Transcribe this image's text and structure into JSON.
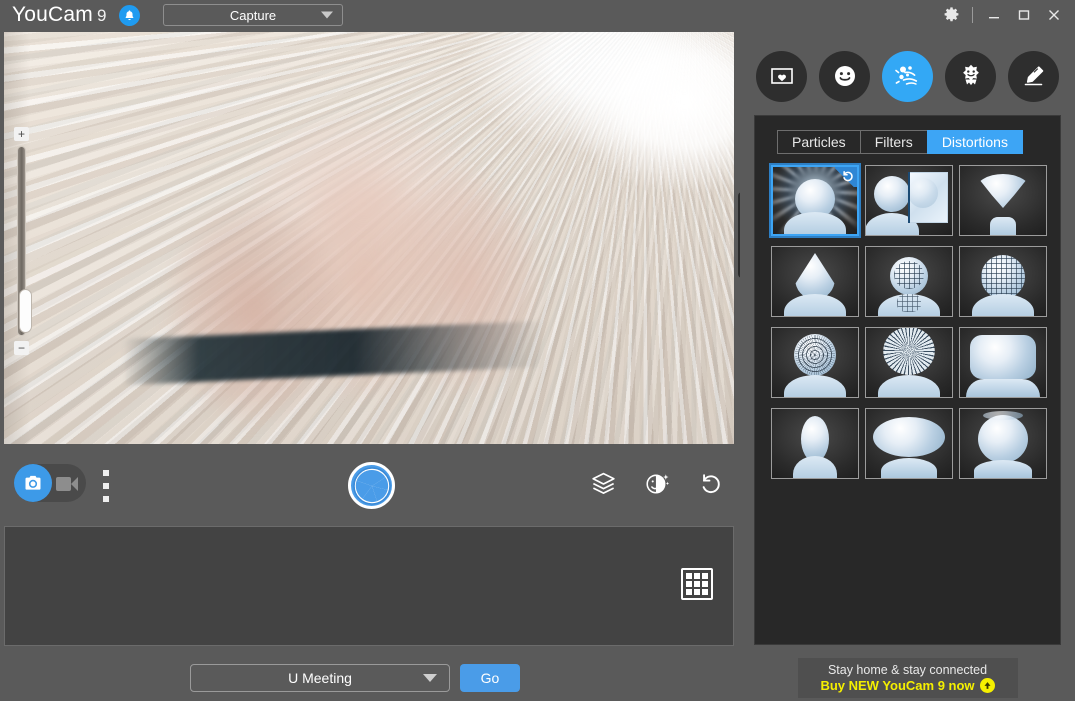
{
  "app": {
    "brand_name": "YouCam",
    "brand_version": "9",
    "bell_icon": "bell-icon"
  },
  "titlebar": {
    "capture_mode": "Capture",
    "capture_caret_icon": "chevron-down-icon",
    "settings_icon": "gear-icon",
    "minimize_icon": "minimize-icon",
    "maximize_icon": "maximize-icon",
    "close_icon": "close-icon"
  },
  "preview": {
    "zoom_in_label": "+",
    "zoom_out_label": "−"
  },
  "controls": {
    "photo_mode_icon": "camera-icon",
    "video_mode_icon": "video-camera-icon",
    "more_options_icon": "more-vertical-icon",
    "shutter_icon": "shutter-aperture-icon",
    "layers_icon": "layers-icon",
    "beautify_icon": "beautify-face-icon",
    "reset_icon": "reset-rotate-icon"
  },
  "gallery": {
    "grid_view_icon": "grid-view-icon"
  },
  "footer": {
    "meeting_app": "U Meeting",
    "meeting_caret_icon": "chevron-down-icon",
    "go_label": "Go"
  },
  "right_panel": {
    "category_icons": [
      {
        "name": "frames-icon",
        "label": "Frames",
        "active": false
      },
      {
        "name": "emotion-icon",
        "label": "Emotions",
        "active": false
      },
      {
        "name": "particles-icon",
        "label": "Particles",
        "active": true
      },
      {
        "name": "avatar-icon",
        "label": "Avatars",
        "active": false
      },
      {
        "name": "draw-icon",
        "label": "Draw",
        "active": false
      }
    ],
    "tabs": [
      {
        "label": "Particles",
        "active": false
      },
      {
        "label": "Filters",
        "active": false
      },
      {
        "label": "Distortions",
        "active": true
      }
    ],
    "selected_effect_index": 0,
    "effects": [
      {
        "name": "light-burst-distortion",
        "selected": true,
        "badge_icon": "reset-rotate-icon"
      },
      {
        "name": "mirror-distortion",
        "selected": false,
        "badge_icon": null
      },
      {
        "name": "funnel-distortion",
        "selected": false,
        "badge_icon": null
      },
      {
        "name": "cone-head-distortion",
        "selected": false,
        "badge_icon": null
      },
      {
        "name": "mesh-face-distortion",
        "selected": false,
        "badge_icon": null
      },
      {
        "name": "grid-sphere-distortion",
        "selected": false,
        "badge_icon": null
      },
      {
        "name": "pinch-mesh-distortion",
        "selected": false,
        "badge_icon": null
      },
      {
        "name": "swirl-distortion",
        "selected": false,
        "badge_icon": null
      },
      {
        "name": "square-head-distortion",
        "selected": false,
        "badge_icon": null
      },
      {
        "name": "narrow-head-distortion",
        "selected": false,
        "badge_icon": null
      },
      {
        "name": "wide-head-distortion",
        "selected": false,
        "badge_icon": null
      },
      {
        "name": "bubble-head-distortion",
        "selected": false,
        "badge_icon": null
      }
    ],
    "collapse_icon": "collapse-left-icon"
  },
  "promo": {
    "line1": "Stay home & stay connected",
    "line2": "Buy NEW YouCam 9 now",
    "arrow_icon": "arrow-up-circle-icon"
  },
  "colors": {
    "accent_blue": "#3da5f5",
    "panel_dark": "#282828",
    "chrome_gray": "#5a5a5a",
    "promo_yellow": "#f5f000"
  }
}
